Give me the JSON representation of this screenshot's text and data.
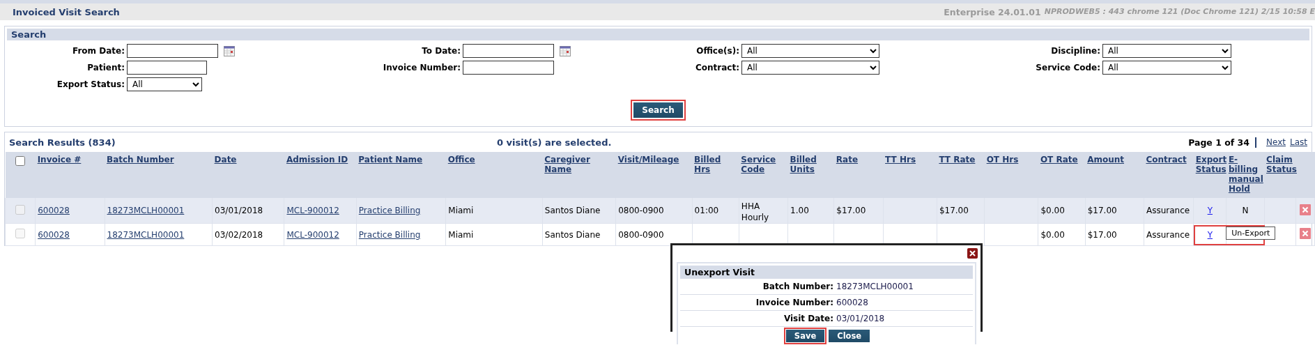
{
  "window": {
    "title": "Invoiced Visit Search",
    "version": "Enterprise 24.01.01",
    "server_info": "NPRODWEB5 : 443 chrome 121 (Doc Chrome 121) 2/15 10:58 E"
  },
  "search": {
    "title": "Search",
    "fields": [
      {
        "label": "From Date:",
        "kind": "date"
      },
      {
        "label": "To Date:",
        "kind": "date"
      },
      {
        "label": "Office(s):",
        "kind": "select",
        "value": "All"
      },
      {
        "label": "Discipline:",
        "kind": "select",
        "value": "All"
      },
      {
        "label": "Patient:",
        "kind": "text"
      },
      {
        "label": "Invoice Number:",
        "kind": "text"
      },
      {
        "label": "Contract:",
        "kind": "select",
        "value": "All"
      },
      {
        "label": "Service Code:",
        "kind": "select",
        "value": "All"
      },
      {
        "label": "Export Status:",
        "kind": "select",
        "value": "All"
      }
    ],
    "button": {
      "label": "Search",
      "highlighted": true
    }
  },
  "results": {
    "title": "Search Results (834)",
    "selection_note": "0 visit(s) are selected.",
    "page": "Page 1 of 34",
    "next": "Next",
    "last": "Last",
    "select_all": {
      "checked": false
    },
    "columns": [
      {
        "label": "Invoice #",
        "kind": "link"
      },
      {
        "label": "Batch Number",
        "kind": "link"
      },
      {
        "label": "Date",
        "kind": "text"
      },
      {
        "label": "Admission ID",
        "kind": "link"
      },
      {
        "label": "Patient Name",
        "kind": "link"
      },
      {
        "label": "Office",
        "kind": "text"
      },
      {
        "label": "Caregiver Name",
        "kind": "text"
      },
      {
        "label": "Visit/Mileage",
        "kind": "text"
      },
      {
        "label": "Billed Hrs",
        "kind": "text"
      },
      {
        "label": "Service Code",
        "kind": "text"
      },
      {
        "label": "Billed Units",
        "kind": "text"
      },
      {
        "label": "Rate",
        "kind": "text"
      },
      {
        "label": "TT Hrs",
        "kind": "text"
      },
      {
        "label": "TT Rate",
        "kind": "text"
      },
      {
        "label": "OT Hrs",
        "kind": "text"
      },
      {
        "label": "OT Rate",
        "kind": "text"
      },
      {
        "label": "Amount",
        "kind": "text"
      },
      {
        "label": "Contract",
        "kind": "text"
      },
      {
        "label": "Export Status",
        "kind": "center-link"
      },
      {
        "label": "E-billing manual Hold",
        "kind": "center"
      },
      {
        "label": "Claim Status",
        "kind": "text"
      }
    ],
    "rows": [
      {
        "checked": false,
        "disabled": true,
        "cells": [
          "600028",
          "18273MCLH00001",
          "03/01/2018",
          "MCL-900012",
          "Practice Billing",
          "Miami",
          "Santos Diane",
          "0800-0900",
          "01:00",
          "HHA Hourly",
          "1.00",
          "$17.00",
          null,
          "$17.00",
          null,
          "$0.00",
          "$17.00",
          "Assurance",
          "Y",
          "N",
          null
        ]
      },
      {
        "checked": false,
        "disabled": true,
        "cells": [
          "600028",
          "18273MCLH00001",
          "03/02/2018",
          "MCL-900012",
          "Practice Billing",
          "Miami",
          "Santos Diane",
          "0800-0900",
          null,
          null,
          null,
          null,
          null,
          null,
          null,
          "$0.00",
          "$17.00",
          "Assurance",
          "Y",
          null,
          null
        ],
        "tooltip": {
          "text": "Un-Export",
          "highlighted": true
        }
      }
    ]
  },
  "dialog": {
    "title": "Unexport Visit",
    "fields": [
      {
        "label": "Batch Number:",
        "value": "18273MCLH00001"
      },
      {
        "label": "Invoice Number:",
        "value": "600028"
      },
      {
        "label": "Visit Date:",
        "value": "03/01/2018"
      }
    ],
    "buttons": [
      {
        "label": "Save",
        "highlighted": true
      },
      {
        "label": "Close",
        "highlighted": false
      }
    ]
  }
}
